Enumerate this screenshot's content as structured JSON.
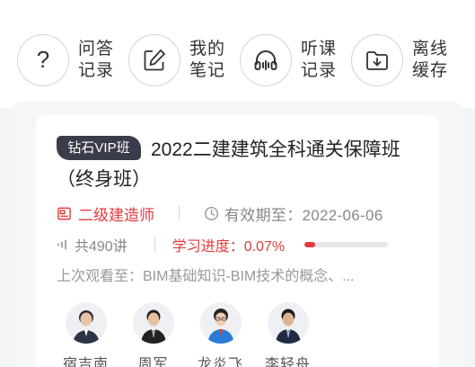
{
  "quick_actions": [
    {
      "line1": "问答",
      "line2": "记录",
      "icon": "question-icon"
    },
    {
      "line1": "我的",
      "line2": "笔记",
      "icon": "edit-note-icon"
    },
    {
      "line1": "听课",
      "line2": "记录",
      "icon": "headphones-icon"
    },
    {
      "line1": "离线",
      "line2": "缓存",
      "icon": "download-folder-icon"
    }
  ],
  "course": {
    "badge": "钻石VIP班",
    "title": "2022二建建筑全科通关保障班（终身班）",
    "category": "二级建造师",
    "expiry": "有效期至：2022-06-06",
    "lectures": "共490讲",
    "progress_label": "学习进度：0.07%",
    "progress_fraction": 0.07,
    "last_watched": "上次观看至：BIM基础知识-BIM技术的概念、...",
    "teachers": [
      {
        "name": "宿吉南"
      },
      {
        "name": "周军"
      },
      {
        "name": "龙炎飞"
      },
      {
        "name": "李轻舟"
      }
    ]
  },
  "colors": {
    "accent": "#e33b3b",
    "badge_bg": "#3a3c4a"
  }
}
